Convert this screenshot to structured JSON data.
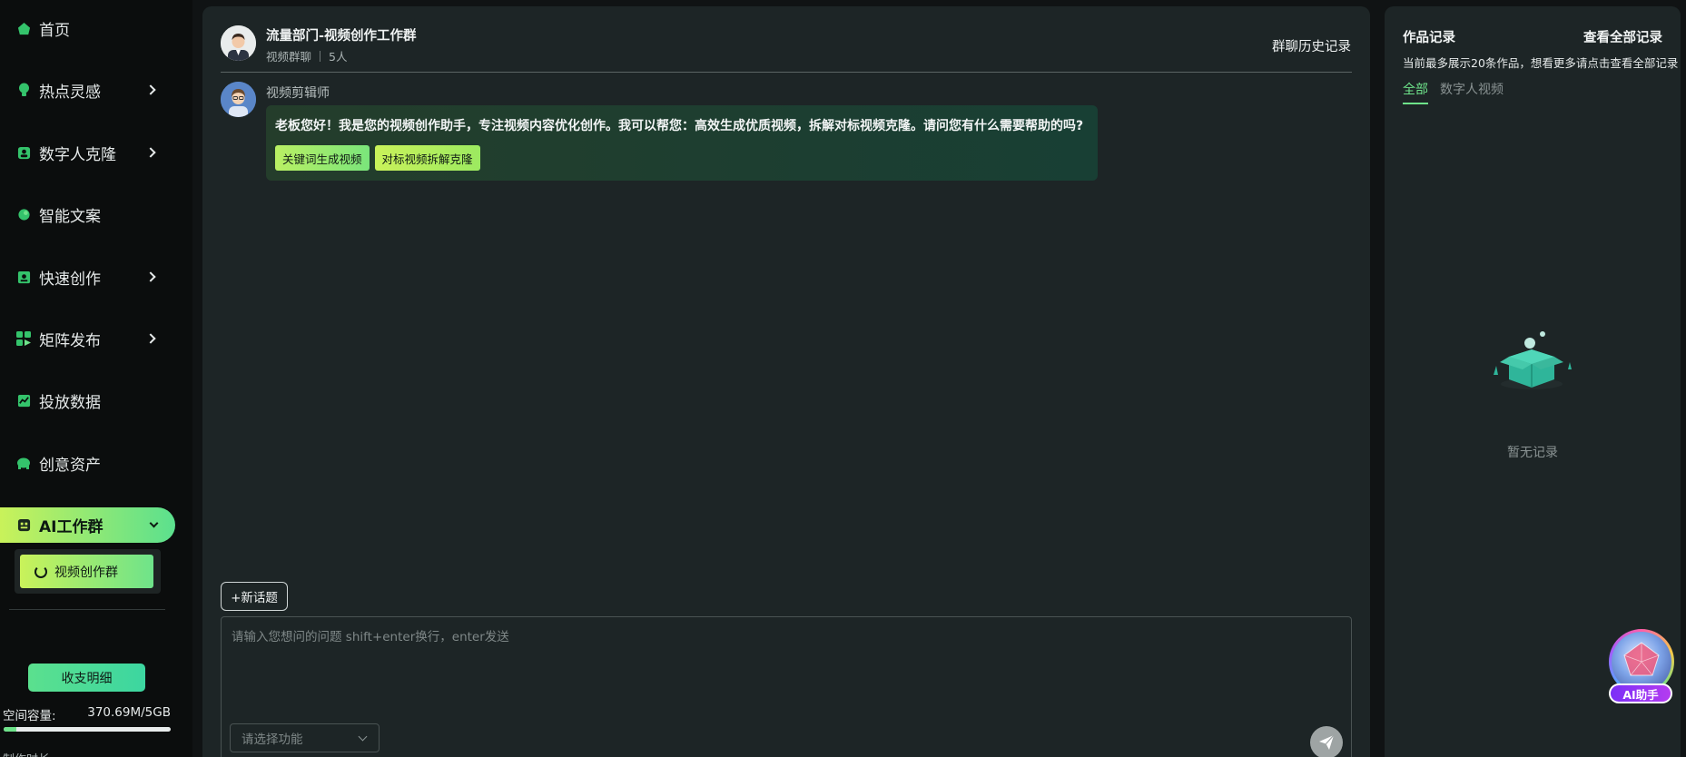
{
  "sidebar": {
    "items": [
      {
        "label": "首页",
        "icon": "home-icon",
        "has_submenu": false
      },
      {
        "label": "热点灵感",
        "icon": "bulb-icon",
        "has_submenu": true
      },
      {
        "label": "数字人克隆",
        "icon": "digital-human-icon",
        "has_submenu": true
      },
      {
        "label": "智能文案",
        "icon": "copywriting-icon",
        "has_submenu": false
      },
      {
        "label": "快速创作",
        "icon": "quick-create-icon",
        "has_submenu": true
      },
      {
        "label": "矩阵发布",
        "icon": "matrix-icon",
        "has_submenu": true
      },
      {
        "label": "投放数据",
        "icon": "data-chart-icon",
        "has_submenu": false
      },
      {
        "label": "创意资产",
        "icon": "assets-icon",
        "has_submenu": false
      }
    ],
    "active_group": {
      "label": "AI工作群",
      "icon": "robot-icon",
      "expanded": true
    },
    "sub_items": [
      {
        "label": "视频创作群",
        "icon": "refresh-icon"
      }
    ],
    "ledger_button": "收支明细",
    "storage": {
      "label": "空间容量:",
      "value": "370.69M/5GB",
      "used_fraction": 0.074
    },
    "cut_row_label": "制作时长"
  },
  "chat": {
    "group_title": "流量部门-视频创作工作群",
    "group_type": "视频群聊",
    "member_count": "5人",
    "history_link": "群聊历史记录",
    "messages": [
      {
        "sender": "视频剪辑师",
        "text": "老板您好！我是您的视频创作助手，专注视频内容优化创作。我可以帮您：高效生成优质视频，拆解对标视频克隆。请问您有什么需要帮助的吗?",
        "actions": [
          "关键词生成视频",
          "对标视频拆解克隆"
        ]
      }
    ],
    "new_topic_button": "+新话题",
    "input_placeholder": "请输入您想问的问题 shift+enter换行，enter发送",
    "function_select_placeholder": "请选择功能"
  },
  "works": {
    "title": "作品记录",
    "view_all": "查看全部记录",
    "note": "当前最多展示20条作品，想看更多请点击查看全部记录",
    "tabs": [
      {
        "label": "全部",
        "active": true
      },
      {
        "label": "数字人视频",
        "active": false
      }
    ],
    "empty_text": "暂无记录"
  },
  "ai_helper": {
    "label": "AI助手"
  },
  "colors": {
    "accent_green": "#6ee38a",
    "accent_lime": "#c9f25a",
    "panel_bg": "#1d2526",
    "sidebar_bg": "#0b0d0d"
  }
}
